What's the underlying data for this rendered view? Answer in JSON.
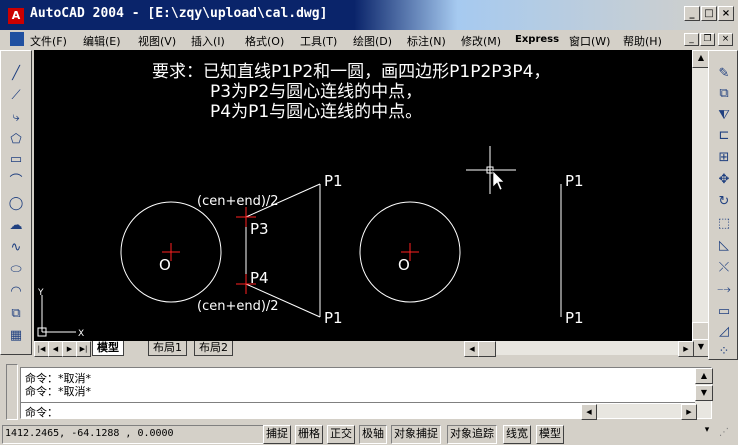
{
  "window": {
    "title": "AutoCAD 2004 - [E:\\zqy\\upload\\cal.dwg]"
  },
  "menu": [
    "文件(F)",
    "编辑(E)",
    "视图(V)",
    "插入(I)",
    "格式(O)",
    "工具(T)",
    "绘图(D)",
    "标注(N)",
    "修改(M)",
    "Express",
    "窗口(W)",
    "帮助(H)"
  ],
  "drawing": {
    "instructions": [
      "要求：已知直线P1P2和一圆，画四边形P1P2P3P4，",
      "P3为P2与圆心连线的中点，",
      "P4为P1与圆心连线的中点。"
    ],
    "labels": {
      "p1_top": "P1",
      "p1_bottom": "P1",
      "p3": "P3",
      "p4": "P4",
      "o_left": "O",
      "o_right": "O",
      "mid_top": "(cen+end)/2",
      "mid_bottom": "(cen+end)/2",
      "p1_right_top": "P1",
      "p1_right_bottom": "P1",
      "ucs_x": "X",
      "ucs_y": "Y"
    }
  },
  "tabs": [
    "模型",
    "布局1",
    "布局2"
  ],
  "command": {
    "lines": [
      "命令：*取消*",
      "命令：*取消*"
    ],
    "prompt": "命令："
  },
  "status": {
    "coords": "1412.2465, -64.1288 , 0.0000",
    "buttons": [
      "捕捉",
      "栅格",
      "正交",
      "极轴",
      "对象捕捉",
      "对象追踪",
      "线宽",
      "模型"
    ]
  },
  "colors": {
    "title_bar": "#0a246a",
    "canvas": "#000000",
    "crosshair_marker": "#ff2020"
  }
}
